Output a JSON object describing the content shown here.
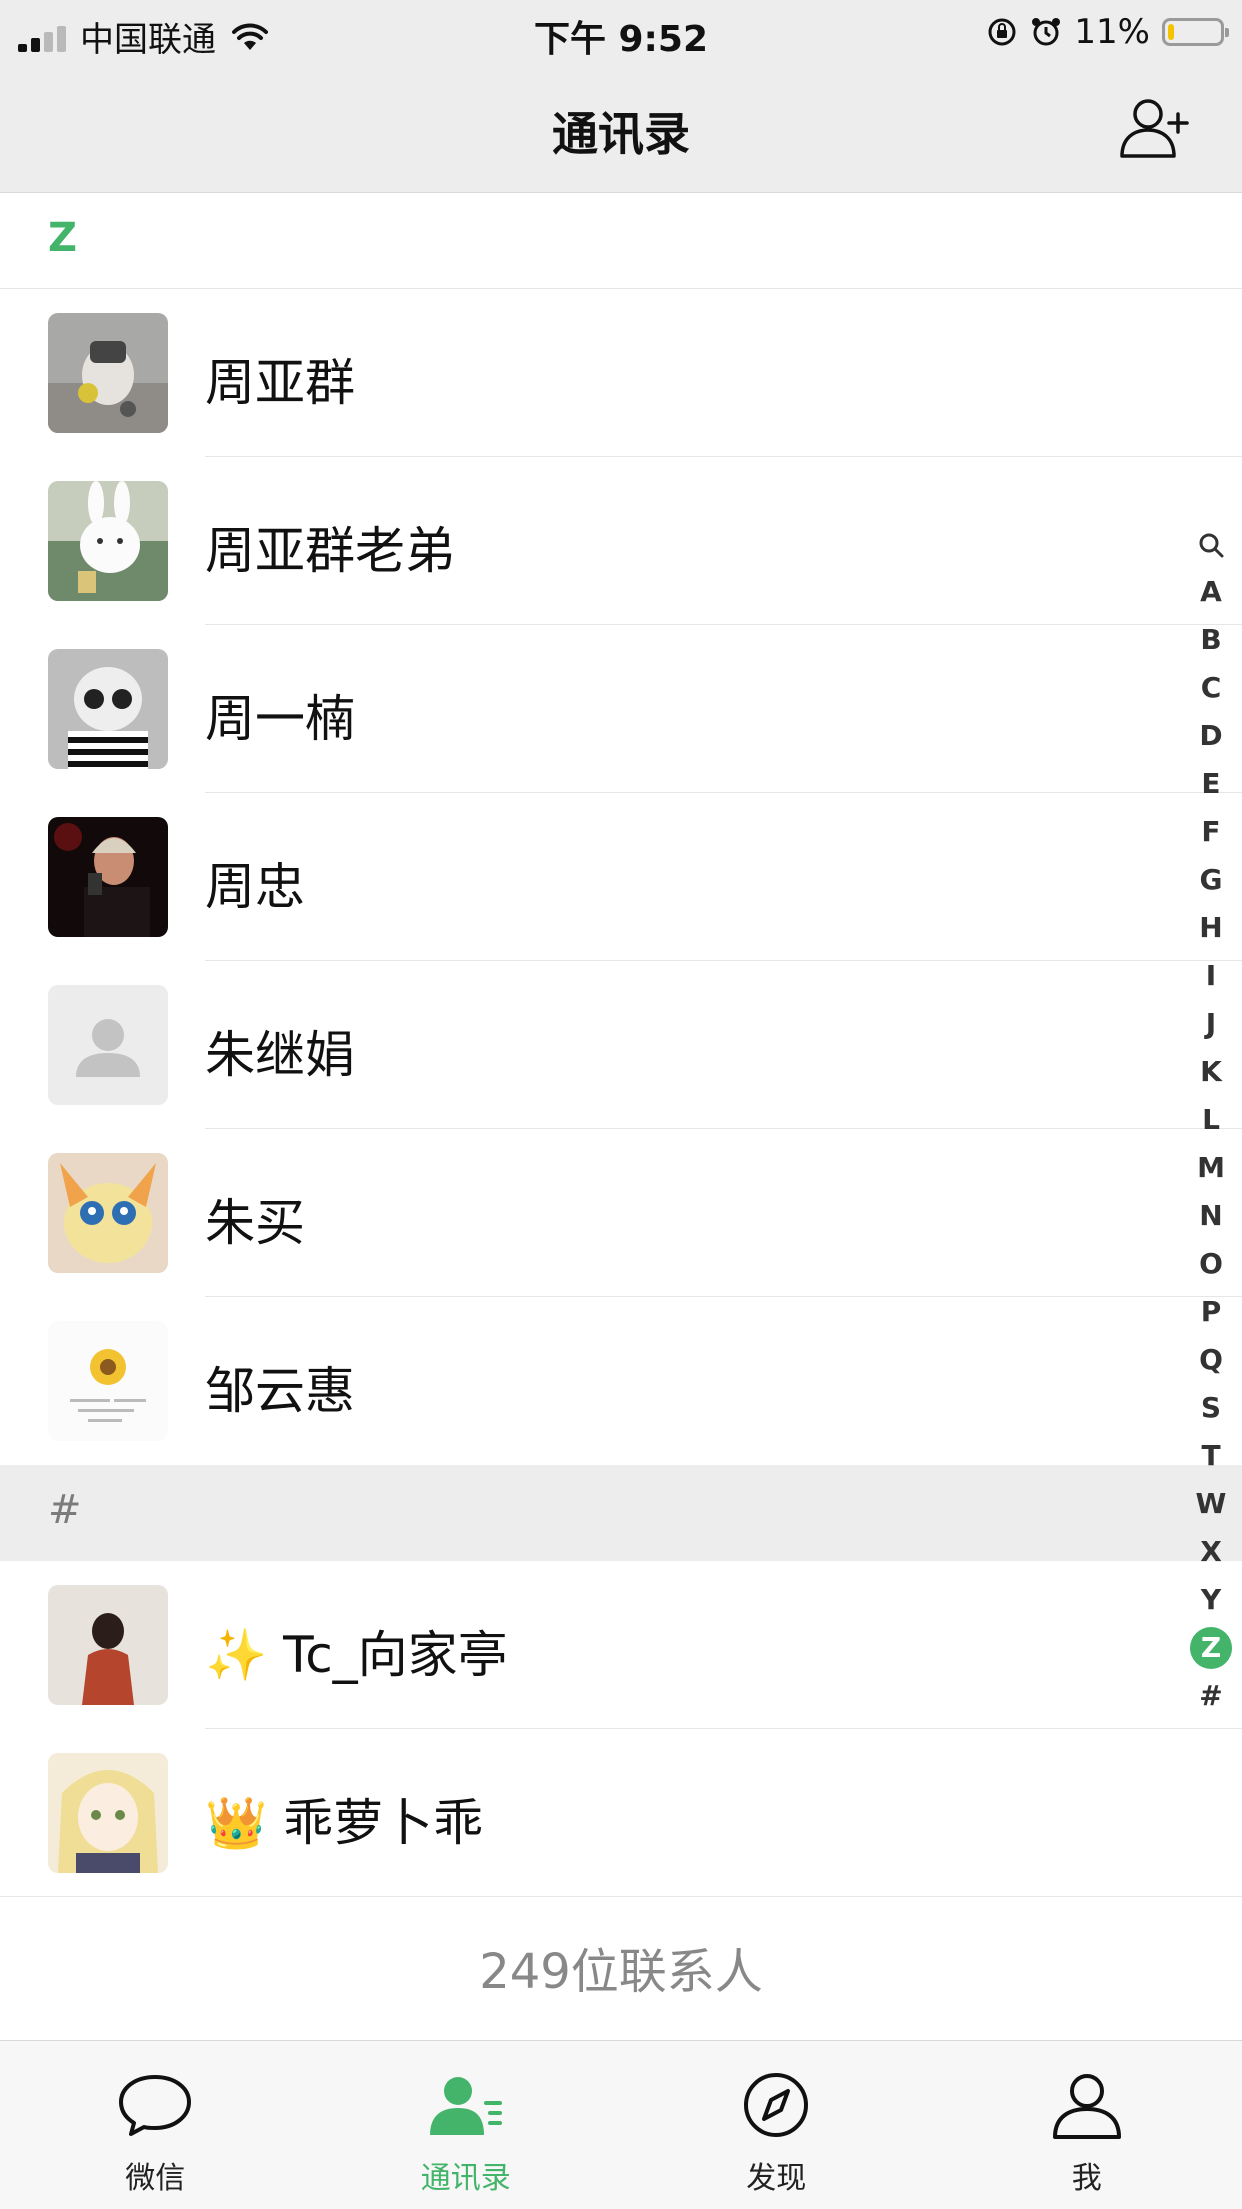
{
  "status_bar": {
    "carrier": "中国联通",
    "time": "下午 9:52",
    "battery_percent_label": "11%",
    "battery_level": 0.11
  },
  "nav": {
    "title": "通讯录",
    "add_friend_icon": "add-contact-icon"
  },
  "sections": [
    {
      "letter": "Z",
      "contacts": [
        {
          "name": "周亚群"
        },
        {
          "name": "周亚群老弟"
        },
        {
          "name": "周一楠"
        },
        {
          "name": "周忠"
        },
        {
          "name": "朱继娟"
        },
        {
          "name": "朱买"
        },
        {
          "name": "邹云惠"
        }
      ]
    },
    {
      "letter": "#",
      "contacts": [
        {
          "name": "✨ Tc_向家亭"
        },
        {
          "name": "👑 乖萝卜乖"
        }
      ]
    }
  ],
  "contact_count_label": "249位联系人",
  "index_bar": {
    "search_icon": "search-icon",
    "letters": [
      "A",
      "B",
      "C",
      "D",
      "E",
      "F",
      "G",
      "H",
      "I",
      "J",
      "K",
      "L",
      "M",
      "N",
      "O",
      "P",
      "Q",
      "S",
      "T",
      "W",
      "X",
      "Y",
      "Z",
      "#"
    ],
    "active": "Z"
  },
  "tabs": [
    {
      "label": "微信",
      "icon": "chat-bubble-icon"
    },
    {
      "label": "通讯录",
      "icon": "contacts-icon",
      "active": true
    },
    {
      "label": "发现",
      "icon": "compass-icon"
    },
    {
      "label": "我",
      "icon": "person-icon"
    }
  ],
  "colors": {
    "accent": "#44b46a",
    "bar_bg": "#ededed",
    "battery_fill": "#f4c400"
  }
}
